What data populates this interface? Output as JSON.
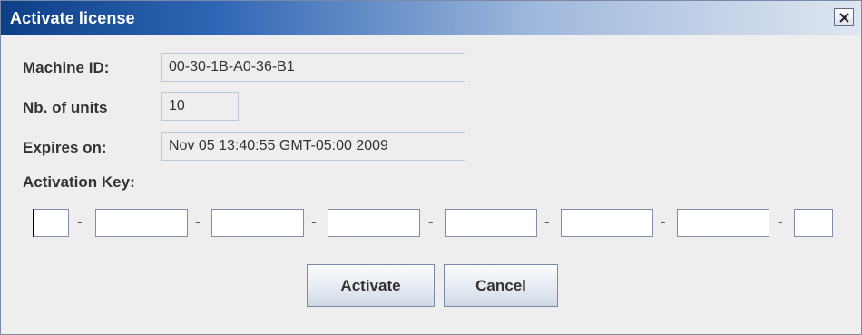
{
  "window": {
    "title": "Activate license",
    "close_icon": "close-x-icon"
  },
  "form": {
    "machine_id_label": "Machine ID:",
    "machine_id_value": "00-30-1B-A0-36-B1",
    "units_label": "Nb. of units",
    "units_value": "10",
    "expires_label": "Expires on:",
    "expires_value": "Nov 05 13:40:55 GMT-05:00 2009",
    "activation_key_label": "Activation Key:",
    "key_separator": "-",
    "key_segments": [
      "",
      "",
      "",
      "",
      "",
      "",
      "",
      ""
    ]
  },
  "buttons": {
    "activate": "Activate",
    "cancel": "Cancel"
  },
  "colors": {
    "titlebar_start": "#0c3f86",
    "titlebar_end": "#dfe6f1",
    "dialog_background": "#eeeeee"
  }
}
